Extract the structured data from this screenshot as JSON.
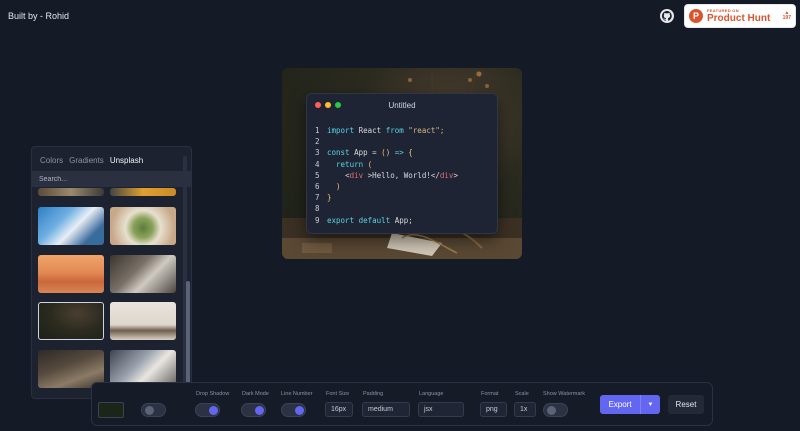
{
  "header": {
    "built_by": "Built by - Rohid",
    "product_hunt": {
      "featured": "FEATURED ON",
      "name": "Product Hunt",
      "votes": "197",
      "arrow": "▲"
    }
  },
  "code_window": {
    "title": "Untitled",
    "lines": [
      {
        "n": "1",
        "parts": [
          [
            "kw",
            "import"
          ],
          [
            "",
            "React"
          ],
          [
            "kw",
            "from"
          ],
          [
            "str",
            "\"react\";"
          ]
        ]
      },
      {
        "n": "2",
        "parts": []
      },
      {
        "n": "3",
        "parts": [
          [
            "kw",
            "const"
          ],
          [
            "",
            "App"
          ],
          [
            "",
            "="
          ],
          [
            "punc",
            "()"
          ],
          [
            "kw",
            "=>"
          ],
          [
            "punc",
            "{"
          ]
        ]
      },
      {
        "n": "4",
        "parts": [
          [
            "",
            "  "
          ],
          [
            "kw",
            "return"
          ],
          [
            "punc",
            "("
          ]
        ]
      },
      {
        "n": "5",
        "parts": [
          [
            "",
            "    "
          ],
          [
            "",
            "<"
          ],
          [
            "tag",
            "div"
          ],
          [
            "",
            ">Hello, World!</"
          ],
          [
            "tag",
            "div"
          ],
          [
            "",
            ">"
          ]
        ]
      },
      {
        "n": "6",
        "parts": [
          [
            "",
            "  "
          ],
          [
            "punc",
            ")"
          ]
        ]
      },
      {
        "n": "7",
        "parts": [
          [
            "punc",
            "}"
          ]
        ]
      },
      {
        "n": "8",
        "parts": []
      },
      {
        "n": "9",
        "parts": [
          [
            "kw",
            "export"
          ],
          [
            "kw",
            "default"
          ],
          [
            "",
            "App;"
          ]
        ]
      }
    ]
  },
  "panel": {
    "tabs": [
      "Colors",
      "Gradients",
      "Unsplash"
    ],
    "active_tab": "Unsplash",
    "search_placeholder": "Search..."
  },
  "toolbar": {
    "drop_shadow_label": "Drop Shadow",
    "dark_mode_label": "Dark Mode",
    "line_number_label": "Line Number",
    "font_size_label": "Font Size",
    "font_size_value": "16px",
    "padding_label": "Padding",
    "padding_value": "medium",
    "language_label": "Language",
    "language_value": "jsx",
    "format_label": "Format",
    "format_value": "png",
    "scale_label": "Scale",
    "scale_value": "1x",
    "watermark_label": "Show Watermark",
    "export_label": "Export",
    "reset_label": "Reset"
  },
  "colors": {
    "accent": "#6366f1",
    "background": "#151a27",
    "product_hunt": "#da552f"
  }
}
